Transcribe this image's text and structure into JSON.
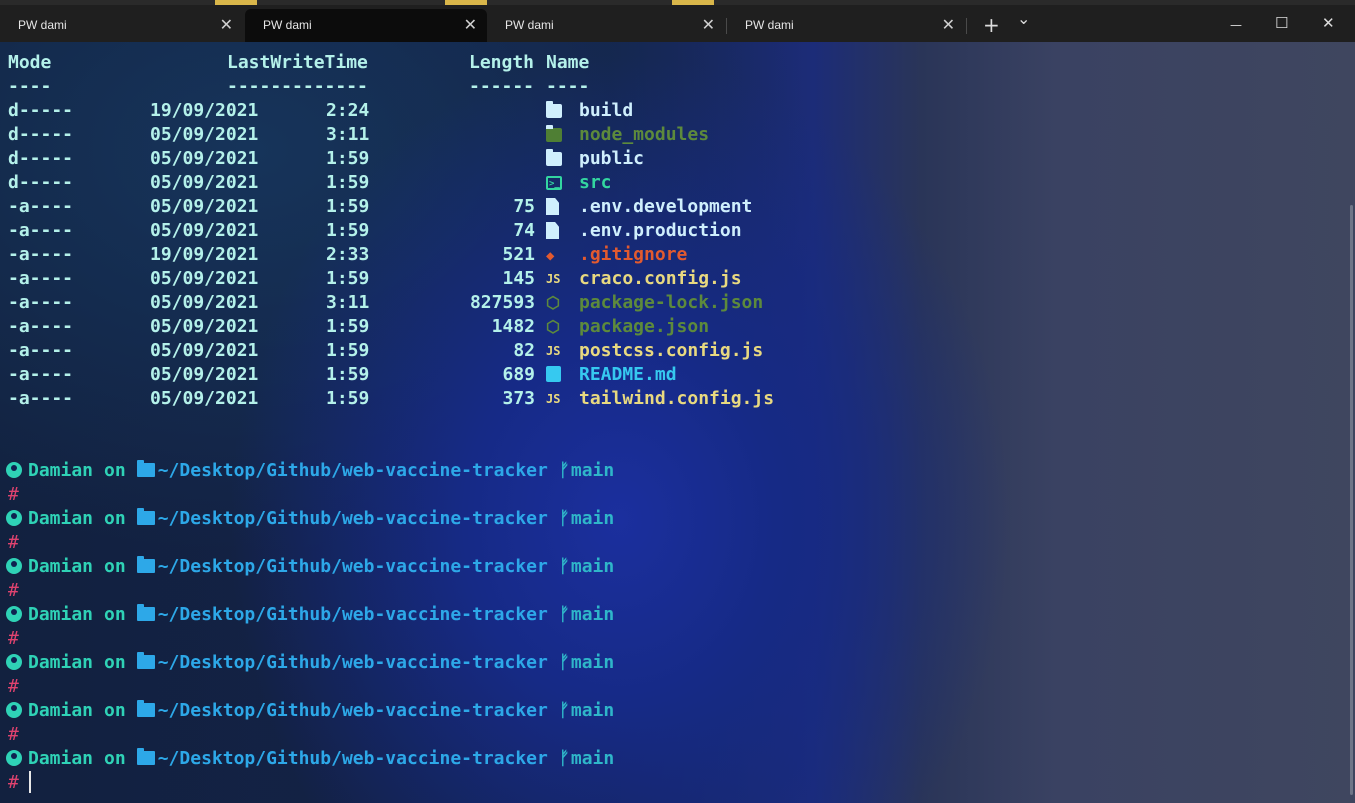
{
  "window": {
    "tabs": [
      {
        "label": "PW dami",
        "active": false
      },
      {
        "label": "PW dami",
        "active": true
      },
      {
        "label": "PW dami",
        "active": false
      },
      {
        "label": "PW dami",
        "active": false
      }
    ],
    "close_glyph": "✕",
    "new_tab_glyph": "+",
    "dropdown_glyph": "⌄",
    "minimize_glyph": "—",
    "maximize_glyph": "☐",
    "window_close_glyph": "✕"
  },
  "listing": {
    "headers": {
      "mode": "Mode",
      "time": "LastWriteTime",
      "length": "Length",
      "name": "Name"
    },
    "underlines": {
      "mode": "----",
      "time": "-------------",
      "length": "------",
      "name": "----"
    },
    "rows": [
      {
        "mode": "d-----",
        "date": "19/09/2021",
        "time": "2:24",
        "length": "",
        "name": "build",
        "icon": "folder-icon",
        "color": "#cfeffd"
      },
      {
        "mode": "d-----",
        "date": "05/09/2021",
        "time": "3:11",
        "length": "",
        "name": "node_modules",
        "icon": "node-folder-icon",
        "color": "#5d8a3c"
      },
      {
        "mode": "d-----",
        "date": "05/09/2021",
        "time": "1:59",
        "length": "",
        "name": "public",
        "icon": "folder-icon",
        "color": "#cfeffd"
      },
      {
        "mode": "d-----",
        "date": "05/09/2021",
        "time": "1:59",
        "length": "",
        "name": "src",
        "icon": "terminal-folder-icon",
        "color": "#33d6a0"
      },
      {
        "mode": "-a----",
        "date": "05/09/2021",
        "time": "1:59",
        "length": "75",
        "name": ".env.development",
        "icon": "file-icon",
        "color": "#cfeffd"
      },
      {
        "mode": "-a----",
        "date": "05/09/2021",
        "time": "1:59",
        "length": "74",
        "name": ".env.production",
        "icon": "file-icon",
        "color": "#cfeffd"
      },
      {
        "mode": "-a----",
        "date": "19/09/2021",
        "time": "2:33",
        "length": "521",
        "name": ".gitignore",
        "icon": "git-icon",
        "color": "#e25a2f"
      },
      {
        "mode": "-a----",
        "date": "05/09/2021",
        "time": "1:59",
        "length": "145",
        "name": "craco.config.js",
        "icon": "js-icon",
        "color": "#e8d980"
      },
      {
        "mode": "-a----",
        "date": "05/09/2021",
        "time": "3:11",
        "length": "827593",
        "name": "package-lock.json",
        "icon": "nodejs-icon",
        "color": "#5d8a3c"
      },
      {
        "mode": "-a----",
        "date": "05/09/2021",
        "time": "1:59",
        "length": "1482",
        "name": "package.json",
        "icon": "nodejs-icon",
        "color": "#5d8a3c"
      },
      {
        "mode": "-a----",
        "date": "05/09/2021",
        "time": "1:59",
        "length": "82",
        "name": "postcss.config.js",
        "icon": "js-icon",
        "color": "#e8d980"
      },
      {
        "mode": "-a----",
        "date": "05/09/2021",
        "time": "1:59",
        "length": "689",
        "name": "README.md",
        "icon": "markdown-icon",
        "color": "#36c9f0"
      },
      {
        "mode": "-a----",
        "date": "05/09/2021",
        "time": "1:59",
        "length": "373",
        "name": "tailwind.config.js",
        "icon": "js-icon",
        "color": "#e8d980"
      }
    ]
  },
  "prompt": {
    "user": "Damian",
    "on": "on",
    "path": "~/Desktop/Github/web-vaccine-tracker",
    "branch": "main",
    "symbol": "#",
    "repeat_count_label": "7"
  },
  "colors": {
    "header": "#b4f1ea",
    "user": "#2fd2b6",
    "path": "#2da8e8",
    "branch": "#2fb6c9",
    "hash": "#e0436f"
  },
  "js_glyph": "JS",
  "hex_glyph": "⬡",
  "git_glyph": "◆"
}
